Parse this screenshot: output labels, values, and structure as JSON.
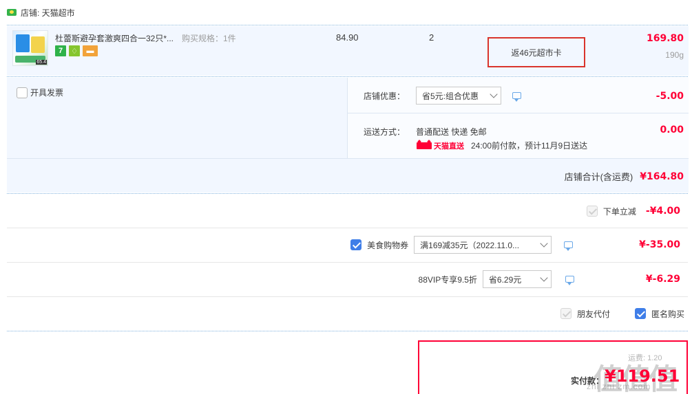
{
  "shop": {
    "label": "店铺: 天猫超市",
    "icon": "tmall-shop-icon"
  },
  "item": {
    "title": "杜蕾斯避孕套激爽四合一32只*...",
    "spec": "购买规格：1件",
    "unit_price": "84.90",
    "quantity": "2",
    "rebate": "返46元超市卡",
    "total": "169.80",
    "weight": "190g",
    "thumb_tag": "65.4"
  },
  "options": {
    "invoice_label": "开具发票",
    "shop_discount_label": "店铺优惠：",
    "shop_discount_select": "省5元:组合优惠",
    "shop_discount_amount": "-5.00",
    "delivery_label": "运送方式：",
    "delivery_method": "普通配送 快递 免邮",
    "delivery_amount": "0.00",
    "tmall_direct": "天猫直送",
    "delivery_eta": "24:00前付款，预计11月9日送达",
    "shop_total_label": "店铺合计(含运费)",
    "shop_total": "¥164.80"
  },
  "summary": {
    "instant_label": "下单立减",
    "instant_amount": "-¥4.00",
    "coupon_label": "美食购物券",
    "coupon_select": "满169减35元（2022.11.0...",
    "coupon_amount": "¥-35.00",
    "vip_label": "88VIP专享9.5折",
    "vip_select": "省6.29元",
    "vip_amount": "¥-6.29",
    "friend_pay": "朋友代付",
    "anonymous": "匿名购买"
  },
  "pay": {
    "label": "实付款：",
    "amount": "¥119.51",
    "small_text": "运费: 1.20"
  },
  "watermark": {
    "main": "值值值",
    "sub": "zhi zhi zm.com"
  },
  "colors": {
    "price_red": "#ff0036",
    "row_blue": "#f2f7ff",
    "checkbox_blue": "#3f7ee8",
    "highlight_box": "#d9342b"
  }
}
